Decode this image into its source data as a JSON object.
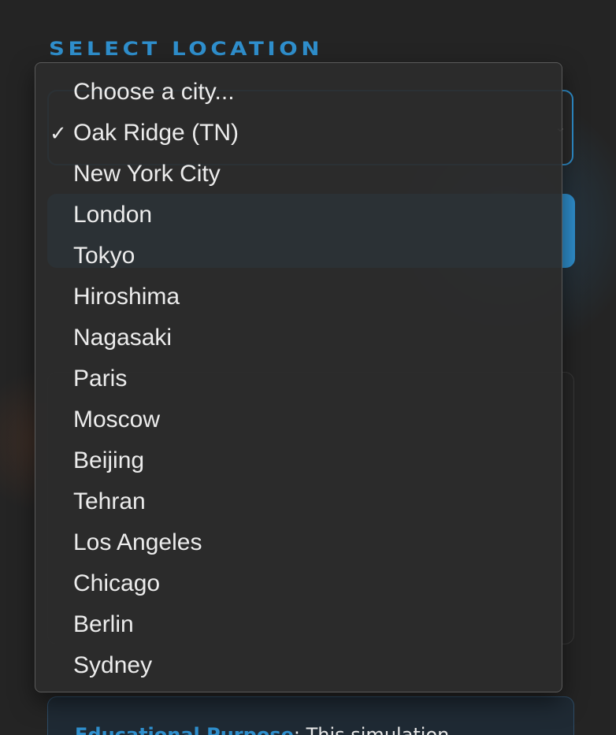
{
  "section_label": "SELECT LOCATION",
  "dropdown": {
    "selected": "Oak Ridge (TN)",
    "options": [
      {
        "label": "Choose a city...",
        "checked": false
      },
      {
        "label": "Oak Ridge (TN)",
        "checked": true
      },
      {
        "label": "New York City",
        "checked": false
      },
      {
        "label": "London",
        "checked": false
      },
      {
        "label": "Tokyo",
        "checked": false
      },
      {
        "label": "Hiroshima",
        "checked": false
      },
      {
        "label": "Nagasaki",
        "checked": false
      },
      {
        "label": "Paris",
        "checked": false
      },
      {
        "label": "Moscow",
        "checked": false
      },
      {
        "label": "Beijing",
        "checked": false
      },
      {
        "label": "Tehran",
        "checked": false
      },
      {
        "label": "Los Angeles",
        "checked": false
      },
      {
        "label": "Chicago",
        "checked": false
      },
      {
        "label": "Berlin",
        "checked": false
      },
      {
        "label": "Sydney",
        "checked": false
      }
    ],
    "check_glyph": "✓"
  },
  "notice": {
    "strong": "Educational Purpose",
    "text": ": This simulation"
  },
  "colors": {
    "accent": "#2f8fcd",
    "background": "#242424"
  }
}
